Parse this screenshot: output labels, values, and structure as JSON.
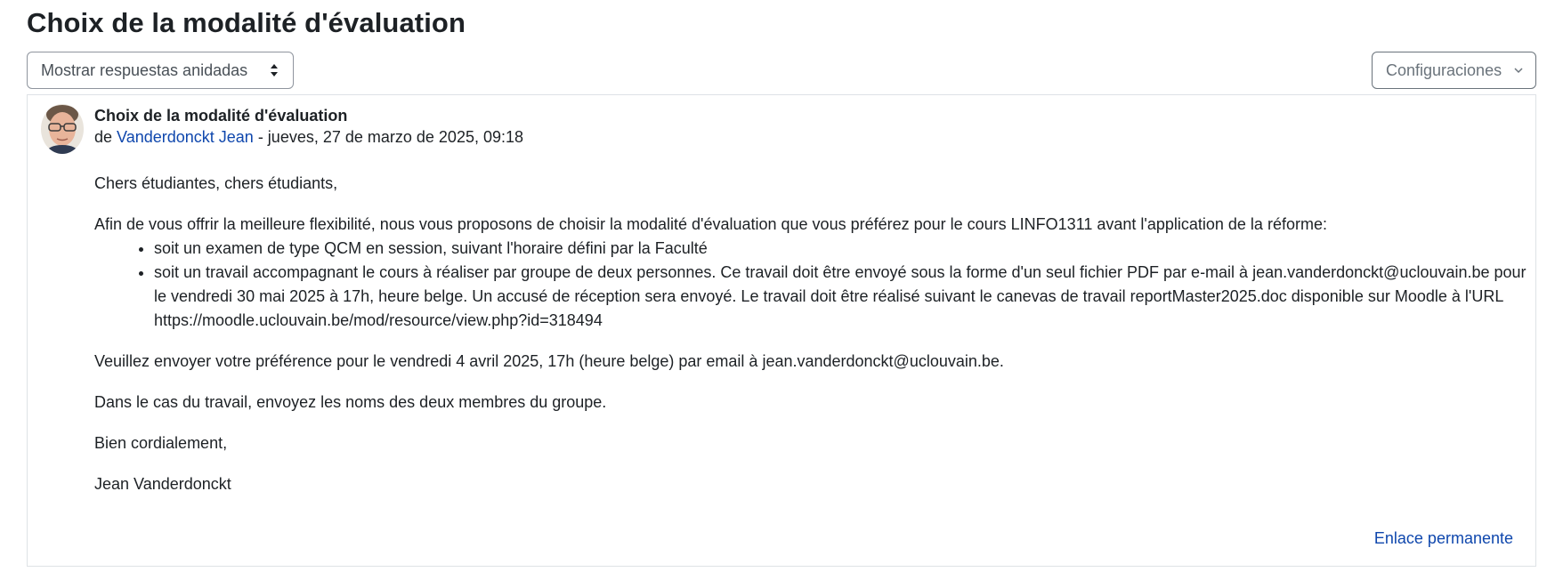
{
  "page": {
    "title": "Choix de la modalité d'évaluation"
  },
  "toolbar": {
    "display_mode_selected": "Mostrar respuestas anidadas",
    "settings_label": "Configuraciones"
  },
  "post": {
    "subject": "Choix de la modalité d'évaluation",
    "by_prefix": "de ",
    "author": "Vanderdonckt Jean",
    "date": " - jueves, 27 de marzo de 2025, 09:18",
    "greeting": "Chers étudiantes, chers étudiants,",
    "intro": "Afin de vous offrir la meilleure flexibilité, nous vous proposons de choisir la modalité d'évaluation que vous préférez pour le cours LINFO1311 avant l'application de la réforme:",
    "options": [
      "soit un examen de type QCM en session, suivant l'horaire défini par la Faculté",
      "soit un travail accompagnant le cours à réaliser par groupe de deux personnes. Ce travail doit être envoyé sous la forme d'un seul fichier PDF par e-mail à jean.vanderdonckt@uclouvain.be pour le vendredi 30 mai 2025 à 17h, heure belge.  Un accusé de réception sera envoyé. Le travail doit être réalisé suivant le canevas de travail reportMaster2025.doc disponible sur Moodle à l'URL  https://moodle.uclouvain.be/mod/resource/view.php?id=318494"
    ],
    "request": "Veuillez envoyer votre préférence pour le vendredi 4 avril 2025, 17h (heure belge) par email à jean.vanderdonckt@uclouvain.be.",
    "group_note": "Dans le cas du travail, envoyez les noms des deux membres du groupe.",
    "closing": "Bien cordialement,",
    "signature": "Jean Vanderdonckt",
    "permalink_label": "Enlace permanente"
  },
  "colors": {
    "link": "#0f47ad",
    "text": "#1d2125",
    "border": "#dee2e6"
  }
}
